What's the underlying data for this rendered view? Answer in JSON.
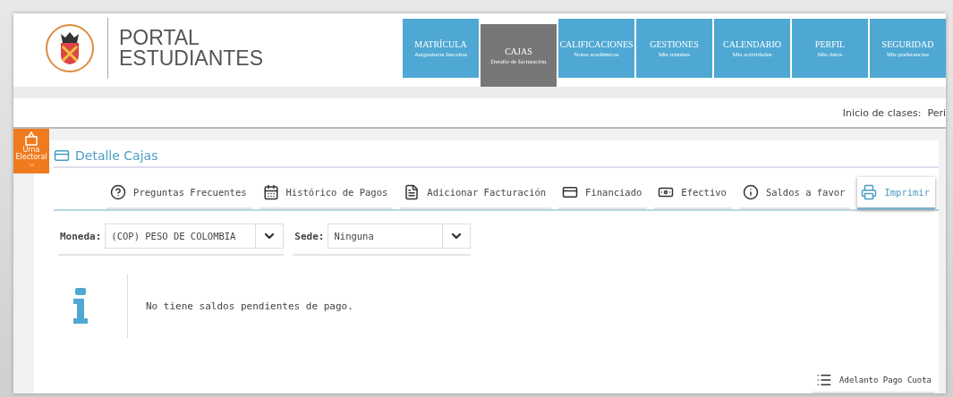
{
  "header": {
    "title_line1": "PORTAL",
    "title_line2": "ESTUDIANTES"
  },
  "nav": [
    {
      "title": "MATRÍCULA",
      "subtitle": "Asignaturas Inscritas",
      "selected": false
    },
    {
      "title": "CAJAS",
      "subtitle": "Detalle de facturación",
      "selected": true
    },
    {
      "title": "CALIFICACIONES",
      "subtitle": "Notas académicas",
      "selected": false
    },
    {
      "title": "GESTIONES",
      "subtitle": "Mis trámites",
      "selected": false
    },
    {
      "title": "CALENDARIO",
      "subtitle": "Mis actividades",
      "selected": false
    },
    {
      "title": "PERFIL",
      "subtitle": "Mis datos",
      "selected": false
    },
    {
      "title": "SEGURIDAD",
      "subtitle": "Mis preferencias",
      "selected": false
    }
  ],
  "info_bar": {
    "text": "Inicio de clases:  Peri"
  },
  "side_badge": {
    "label": "Urna Electoral"
  },
  "page_title": "Detalle Cajas",
  "actions": [
    {
      "label": "Preguntas Frecuentes",
      "selected": false
    },
    {
      "label": "Histórico de Pagos",
      "selected": false
    },
    {
      "label": "Adicionar Facturación",
      "selected": false
    },
    {
      "label": "Financiado",
      "selected": false
    },
    {
      "label": "Efectivo",
      "selected": false
    },
    {
      "label": "Saldos a favor",
      "selected": false
    },
    {
      "label": "Imprimir",
      "selected": true
    }
  ],
  "filters": [
    {
      "label": "Moneda:",
      "value": "(COP) PESO DE COLOMBIA"
    },
    {
      "label": "Sede:",
      "value": "Ninguna"
    }
  ],
  "message": "No tiene saldos pendientes de pago.",
  "footer_action": {
    "label": "Adelanto Pago Cuota"
  }
}
